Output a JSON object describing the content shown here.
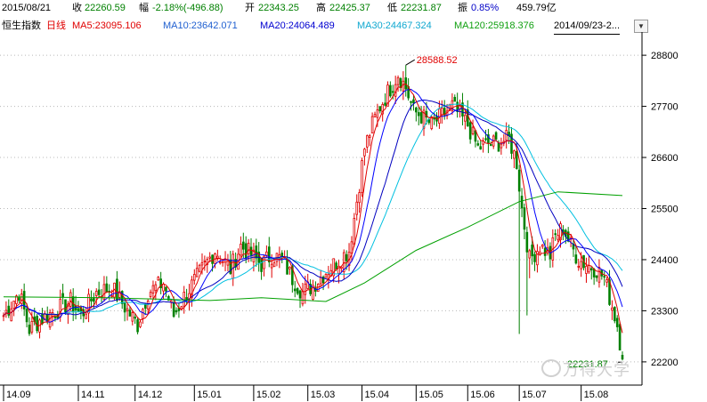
{
  "info": {
    "date": "2015/08/21",
    "close_label": "收",
    "close": "22260.59",
    "change_label": "幅",
    "change": "-2.18%(-496.88)",
    "open_label": "开",
    "open": "22343.25",
    "high_label": "高",
    "high": "22425.37",
    "low_label": "低",
    "low": "22231.87",
    "amp_label": "振",
    "amp": "0.85%",
    "volume": "459.79亿"
  },
  "ma_bar": {
    "index_name": "恒生指数",
    "period": "日线",
    "ma5": "MA5:23095.106",
    "ma10": "MA10:23642.071",
    "ma20": "MA20:24064.489",
    "ma30": "MA30:24467.324",
    "ma120": "MA120:25918.376",
    "date_range": "2014/09/23-2..."
  },
  "watermark": "万得大学",
  "colors": {
    "up": "#e00000",
    "down": "#008000",
    "ma5": "#e00000",
    "ma10": "#0000ff",
    "ma20": "#0000c0",
    "ma30": "#00c0e0",
    "ma120": "#00a000",
    "grid": "#b8b8b8"
  },
  "chart_data": {
    "type": "candlestick",
    "y_ticks": [
      28800,
      27700,
      26600,
      25500,
      24400,
      23300,
      22200
    ],
    "ylim": [
      21700,
      29300
    ],
    "x_tick_labels": [
      "14.09",
      "14.11",
      "14.12",
      "15.01",
      "15.02",
      "15.03",
      "15.04",
      "15.05",
      "15.06",
      "15.07",
      "15.08"
    ],
    "x_tick_positions": [
      0,
      29,
      51,
      74,
      97,
      118,
      139,
      160,
      180,
      200,
      224
    ],
    "n_bars": 241,
    "annotations": [
      {
        "label": "28588.52",
        "x": 156,
        "y": 28588.52
      },
      {
        "label": "22231.87",
        "x": 240,
        "y": 22231.87
      }
    ],
    "ma_series": [
      "MA5",
      "MA10",
      "MA20",
      "MA30",
      "MA120"
    ],
    "ma120_path": [
      [
        0,
        23600
      ],
      [
        40,
        23580
      ],
      [
        80,
        23520
      ],
      [
        100,
        23580
      ],
      [
        125,
        23500
      ],
      [
        140,
        23900
      ],
      [
        160,
        24600
      ],
      [
        180,
        25100
      ],
      [
        200,
        25650
      ],
      [
        215,
        25860
      ],
      [
        240,
        25780
      ]
    ],
    "anchors": [
      [
        0,
        23200
      ],
      [
        6,
        23700
      ],
      [
        10,
        22900
      ],
      [
        14,
        23100
      ],
      [
        20,
        23300
      ],
      [
        26,
        23500
      ],
      [
        30,
        23200
      ],
      [
        36,
        23700
      ],
      [
        42,
        23800
      ],
      [
        48,
        23300
      ],
      [
        52,
        23000
      ],
      [
        56,
        23700
      ],
      [
        62,
        23900
      ],
      [
        66,
        23200
      ],
      [
        70,
        23600
      ],
      [
        76,
        24100
      ],
      [
        82,
        24600
      ],
      [
        88,
        24200
      ],
      [
        92,
        24700
      ],
      [
        96,
        24500
      ],
      [
        100,
        24300
      ],
      [
        104,
        24500
      ],
      [
        108,
        24400
      ],
      [
        112,
        24000
      ],
      [
        116,
        23700
      ],
      [
        120,
        23850
      ],
      [
        126,
        24200
      ],
      [
        130,
        24400
      ],
      [
        134,
        24600
      ],
      [
        136,
        25300
      ],
      [
        140,
        26800
      ],
      [
        143,
        27300
      ],
      [
        146,
        27700
      ],
      [
        150,
        28100
      ],
      [
        153,
        28400
      ],
      [
        156,
        28100
      ],
      [
        159,
        27600
      ],
      [
        162,
        27500
      ],
      [
        166,
        27300
      ],
      [
        170,
        27500
      ],
      [
        174,
        27700
      ],
      [
        177,
        27500
      ],
      [
        180,
        27300
      ],
      [
        184,
        26800
      ],
      [
        188,
        26900
      ],
      [
        191,
        26900
      ],
      [
        196,
        27000
      ],
      [
        199,
        26500
      ],
      [
        201,
        25500
      ],
      [
        204,
        24400
      ],
      [
        208,
        24700
      ],
      [
        212,
        24500
      ],
      [
        214,
        24900
      ],
      [
        217,
        25100
      ],
      [
        220,
        24700
      ],
      [
        223,
        24400
      ],
      [
        226,
        24300
      ],
      [
        230,
        24200
      ],
      [
        233,
        24000
      ],
      [
        236,
        23400
      ],
      [
        238,
        23000
      ],
      [
        240,
        22300
      ]
    ]
  }
}
